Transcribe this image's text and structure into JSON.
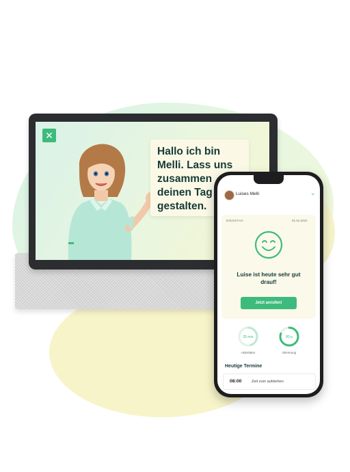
{
  "tablet": {
    "speech": "Hallo ich bin Melli. Lass uns zusammen deinen Tag gestalten.",
    "logo_icon": "close-x-logo-icon"
  },
  "phone": {
    "user_name": "Luises Melli",
    "day": "DIENSTAG",
    "date": "01.02.2022",
    "status": "Luise ist heute sehr gut drauf!",
    "call_button": "Jetzt anrufen!",
    "metrics": [
      {
        "value": "25 min",
        "label": "Aktivitäten",
        "progress": 0.45
      },
      {
        "value": "80 p",
        "label": "Stimmung",
        "progress": 0.8
      }
    ],
    "section_title": "Heutige Termine",
    "appointments": [
      {
        "time": "08:00",
        "text": "Zeit zum aufstehen"
      }
    ]
  },
  "colors": {
    "accent": "#3dbb7c",
    "text_dark": "#163a38",
    "card_bg": "#fbf9ea"
  }
}
